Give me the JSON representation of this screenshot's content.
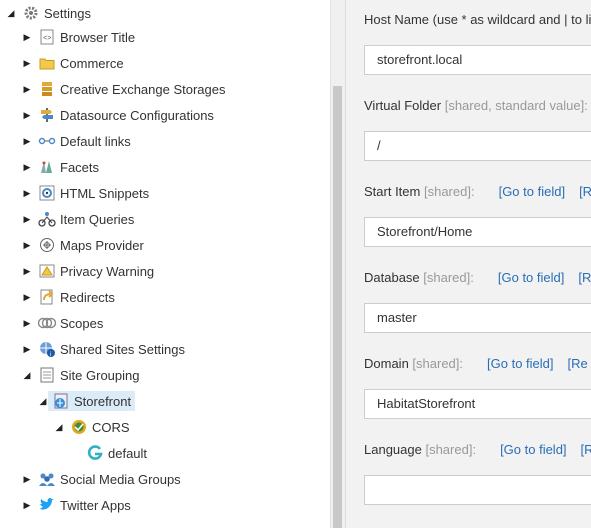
{
  "colors": {
    "accent": "#2a6db5",
    "selected_bg": "#dcebf8",
    "panel_bg": "#f2f2f2"
  },
  "tree": {
    "root": {
      "label": "Settings",
      "icon": "gear-icon"
    },
    "items": [
      {
        "label": "Browser Title",
        "icon": "html-page-icon"
      },
      {
        "label": "Commerce",
        "icon": "folder-icon"
      },
      {
        "label": "Creative Exchange Storages",
        "icon": "storage-icon"
      },
      {
        "label": "Datasource Configurations",
        "icon": "signpost-icon"
      },
      {
        "label": "Default links",
        "icon": "link-icon"
      },
      {
        "label": "Facets",
        "icon": "facets-icon"
      },
      {
        "label": "HTML Snippets",
        "icon": "code-snippet-icon"
      },
      {
        "label": "Item Queries",
        "icon": "query-icon"
      },
      {
        "label": "Maps Provider",
        "icon": "map-icon"
      },
      {
        "label": "Privacy Warning",
        "icon": "warning-icon"
      },
      {
        "label": "Redirects",
        "icon": "redirect-icon"
      },
      {
        "label": "Scopes",
        "icon": "scopes-icon"
      },
      {
        "label": "Shared Sites Settings",
        "icon": "shared-settings-icon"
      },
      {
        "label": "Site Grouping",
        "icon": "document-icon"
      }
    ],
    "site": {
      "label": "Storefront",
      "icon": "site-icon"
    },
    "cors": {
      "label": "CORS",
      "icon": "cors-icon"
    },
    "cors_default": {
      "label": "default",
      "icon": "g-icon"
    },
    "after": [
      {
        "label": "Social Media Groups",
        "icon": "people-icon"
      },
      {
        "label": "Twitter Apps",
        "icon": "twitter-icon"
      }
    ]
  },
  "fields": [
    {
      "label": "Host Name (use * as wildcard and | to lis",
      "shared": "",
      "links": [],
      "value": "storefront.local"
    },
    {
      "label": "Virtual Folder",
      "shared": "[shared, standard value]:",
      "links": [],
      "value": "/"
    },
    {
      "label": "Start Item",
      "shared": "[shared]:",
      "links": [
        "[Go to field]",
        "[R"
      ],
      "value": "Storefront/Home"
    },
    {
      "label": "Database",
      "shared": "[shared]:",
      "links": [
        "[Go to field]",
        "[R"
      ],
      "value": "master"
    },
    {
      "label": "Domain",
      "shared": "[shared]:",
      "links": [
        "[Go to field]",
        "[Re"
      ],
      "value": "HabitatStorefront"
    },
    {
      "label": "Language",
      "shared": "[shared]:",
      "links": [
        "[Go to field]",
        "[R"
      ],
      "value": ""
    }
  ]
}
